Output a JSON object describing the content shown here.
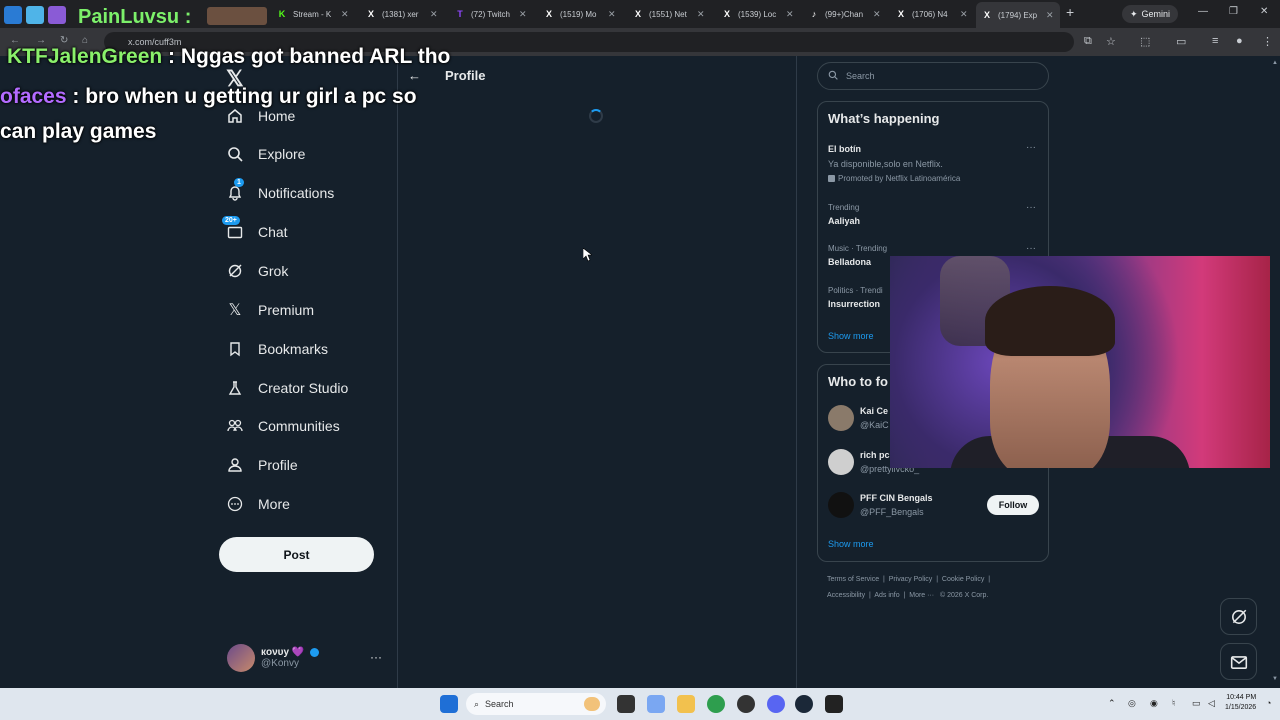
{
  "browser": {
    "tabs": [
      {
        "label": "Stream - K",
        "icon": "K",
        "color": "#53fc18"
      },
      {
        "label": "(1381) xer",
        "icon": "X",
        "color": "#ffffff"
      },
      {
        "label": "(72) Twitch",
        "icon": "T",
        "color": "#9146ff"
      },
      {
        "label": "(1519) Mo",
        "icon": "X",
        "color": "#ffffff"
      },
      {
        "label": "(1551) Net",
        "icon": "X",
        "color": "#ffffff"
      },
      {
        "label": "(1539) Loc",
        "icon": "X",
        "color": "#ffffff"
      },
      {
        "label": "(99+)Chan",
        "icon": "♪",
        "color": "#ffffff"
      },
      {
        "label": "(1706) N4",
        "icon": "X",
        "color": "#ffffff"
      },
      {
        "label": "(1794) Exp",
        "icon": "X",
        "color": "#ffffff"
      }
    ],
    "gemini_label": "Gemini",
    "url": "x.com/cuff3m"
  },
  "overlay": {
    "title": "PainLuvsu :",
    "chat": [
      {
        "user": "KTFJalenGreen",
        "sep": " : ",
        "message": "Nggas got banned ARL tho"
      },
      {
        "user": "ofaces",
        "sep": " : ",
        "message": "bro when u getting ur girl a pc so"
      },
      {
        "user": "",
        "sep": "",
        "message": "can play games"
      }
    ]
  },
  "nav": {
    "items": [
      {
        "label": "Home",
        "icon": "home-icon"
      },
      {
        "label": "Explore",
        "icon": "search-icon"
      },
      {
        "label": "Notifications",
        "icon": "bell-icon",
        "badge": "1"
      },
      {
        "label": "Chat",
        "icon": "mail-icon",
        "badge": "20+"
      },
      {
        "label": "Grok",
        "icon": "grok-icon"
      },
      {
        "label": "Premium",
        "icon": "x-icon"
      },
      {
        "label": "Bookmarks",
        "icon": "bookmark-icon"
      },
      {
        "label": "Creator Studio",
        "icon": "flask-icon"
      },
      {
        "label": "Communities",
        "icon": "people-icon"
      },
      {
        "label": "Profile",
        "icon": "person-icon"
      },
      {
        "label": "More",
        "icon": "more-circle-icon"
      }
    ],
    "post_label": "Post",
    "account": {
      "name": "кονυу",
      "heart": "💜",
      "handle": "@Konvy"
    }
  },
  "main": {
    "back": "←",
    "title": "Profile"
  },
  "right": {
    "search_placeholder": "Search",
    "happening": {
      "title": "What’s happening",
      "promo": {
        "name": "El botín",
        "text": "Ya disponible,solo en Netflix.",
        "meta": "Promoted by Netflix Latinoamérica"
      },
      "trends": [
        {
          "meta": "Trending",
          "name": "Aaliyah"
        },
        {
          "meta": "Music · Trending",
          "name": "Belladona"
        },
        {
          "meta": "Politics · Trendi",
          "name": "Insurrection"
        }
      ],
      "show_more": "Show more"
    },
    "who_to_follow": {
      "title": "Who to fo",
      "accounts": [
        {
          "name": "Kai Ce",
          "handle": "@KaiC"
        },
        {
          "name": "rich pc",
          "handle": "@prettyllvcko_"
        },
        {
          "name": "PFF CIN Bengals",
          "handle": "@PFF_Bengals",
          "button": "Follow"
        }
      ],
      "show_more": "Show more"
    },
    "footer": {
      "line1": [
        "Terms of Service",
        "Privacy Policy",
        "Cookie Policy"
      ],
      "line2": [
        "Accessibility",
        "Ads info",
        "More ···",
        "© 2026 X Corp."
      ]
    }
  },
  "taskbar": {
    "search": "Search",
    "time": "10:44 PM",
    "date": "1/15/2026"
  },
  "colors": {
    "accent": "#1d9bf0",
    "bg": "#15202b"
  }
}
